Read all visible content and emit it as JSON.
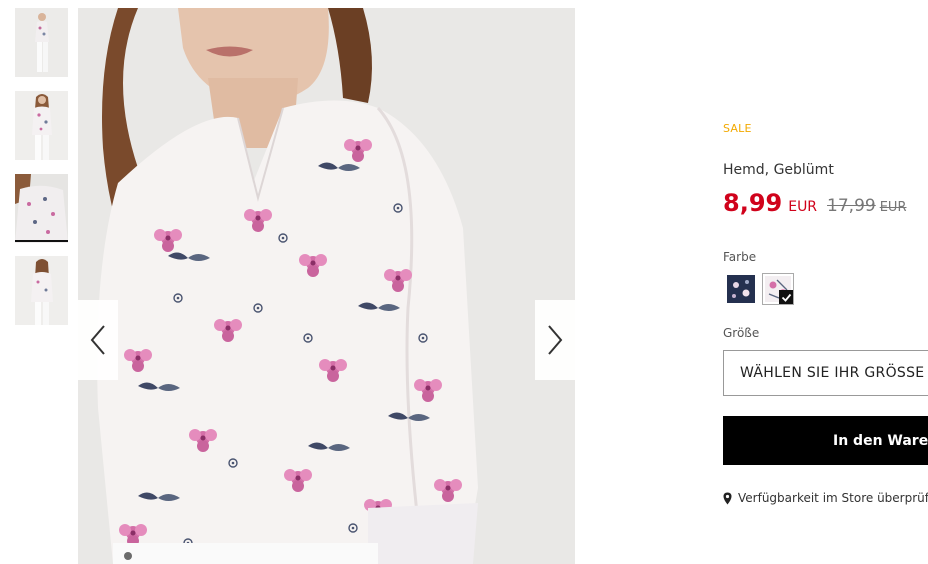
{
  "gallery": {
    "thumbnails": [
      {
        "alt": "Hemd, Geblümt – Ansicht 1",
        "active": false
      },
      {
        "alt": "Hemd, Geblümt – Ansicht 2",
        "active": false
      },
      {
        "alt": "Hemd, Geblümt – Ansicht 3",
        "active": true
      },
      {
        "alt": "Hemd, Geblümt – Ansicht 4",
        "active": false
      }
    ],
    "prev_icon": "chevron-left-icon",
    "next_icon": "chevron-right-icon"
  },
  "product": {
    "badge": "SALE",
    "name": "Hemd, Geblümt",
    "price": "8,99",
    "currency": "EUR",
    "old_price": "17,99",
    "old_currency": "EUR",
    "color_label": "Farbe",
    "colors": [
      {
        "name": "navy floral",
        "swatch": "#24304f",
        "selected": false
      },
      {
        "name": "white floral",
        "swatch": "#f3eef1",
        "selected": true
      }
    ],
    "size_label": "Größe",
    "size_select": "WÄHLEN SIE IHR GRÖSSE",
    "cart_button": "In den Warenkorb",
    "store_link": "Verfügbarkeit im Store überprüfen"
  },
  "colors": {
    "sale": "#f2a900",
    "price": "#d0021b",
    "button_bg": "#000000"
  }
}
